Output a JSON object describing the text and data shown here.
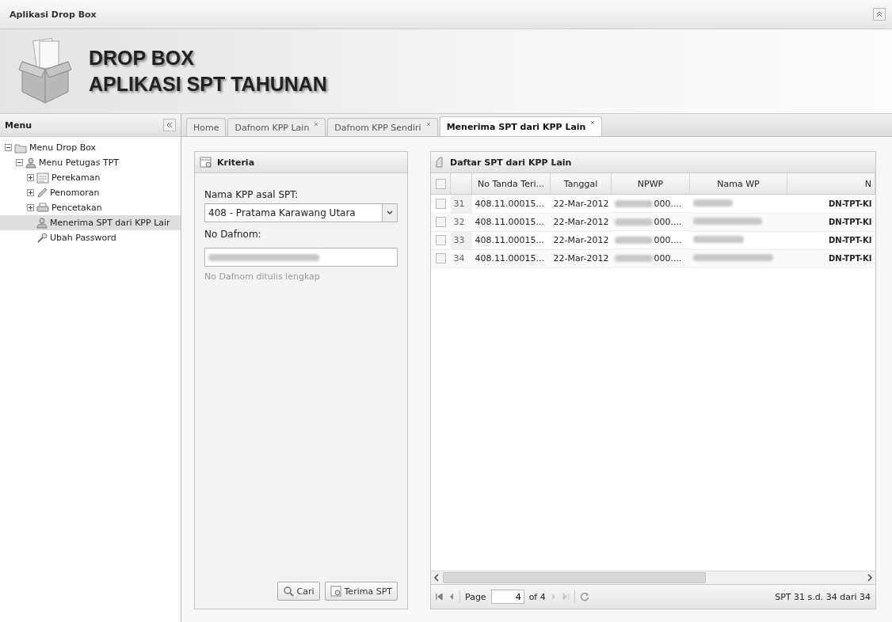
{
  "window": {
    "title": "Aplikasi Drop Box"
  },
  "banner": {
    "line_1": "DROP BOX",
    "line_2": "APLIKASI SPT TAHUNAN"
  },
  "menu": {
    "title": "Menu",
    "items": [
      {
        "label": "Menu Drop Box",
        "kind": "folder",
        "expanded": true,
        "selected": false,
        "children": [
          {
            "label": "Menu Petugas TPT",
            "kind": "user",
            "expanded": true,
            "selected": false,
            "children": [
              {
                "label": "Perekaman",
                "kind": "form",
                "expanded": false,
                "selected": false
              },
              {
                "label": "Penomoran",
                "kind": "pencil",
                "expanded": false,
                "selected": false
              },
              {
                "label": "Pencetakan",
                "kind": "printer",
                "expanded": false,
                "selected": false
              },
              {
                "label": "Menerima SPT dari KPP Lair",
                "kind": "user",
                "selected": true
              },
              {
                "label": "Ubah Password",
                "kind": "key",
                "selected": false
              }
            ]
          }
        ]
      }
    ]
  },
  "tabs": [
    {
      "label": "Home",
      "closable": false,
      "selected": false
    },
    {
      "label": "Dafnom KPP Lain",
      "closable": true,
      "selected": false
    },
    {
      "label": "Dafnom KPP Sendiri",
      "closable": true,
      "selected": false
    },
    {
      "label": "Menerima SPT dari KPP Lain",
      "closable": true,
      "selected": true
    }
  ],
  "criteria": {
    "title": "Kriteria",
    "kpp_label": "Nama KPP asal SPT:",
    "kpp_value": "408 - Pratama Karawang Utara",
    "dafnom_label": "No Dafnom:",
    "dafnom_hint": "No Dafnom ditulis lengkap",
    "buttons": [
      {
        "label": "Cari",
        "kind": "search"
      },
      {
        "label": "Terima SPT",
        "kind": "receive"
      }
    ]
  },
  "grid": {
    "title": "Daftar SPT dari KPP Lain",
    "all_checked": false,
    "columns": [
      "No Tanda Teri...",
      "Tanggal",
      "NPWP",
      "Nama WP",
      "N"
    ],
    "rows": [
      {
        "number": "31",
        "checked": false,
        "no_tanda": "408.11.00015...",
        "tanggal": "22-Mar-2012",
        "npwp": "000....",
        "column_5": "DN-TPT-KI"
      },
      {
        "number": "32",
        "checked": false,
        "no_tanda": "408.11.00015...",
        "tanggal": "22-Mar-2012",
        "npwp": "000....",
        "column_5": "DN-TPT-KI"
      },
      {
        "number": "33",
        "checked": false,
        "no_tanda": "408.11.00015...",
        "tanggal": "22-Mar-2012",
        "npwp": "000....",
        "column_5": "DN-TPT-KI"
      },
      {
        "number": "34",
        "checked": false,
        "no_tanda": "408.11.00015...",
        "tanggal": "22-Mar-2012",
        "npwp": "000....",
        "column_5": "DN-TPT-KI"
      }
    ],
    "pager": {
      "page_label": "Page",
      "page": "4",
      "of": "of 4",
      "summary": "SPT 31 s.d. 34 dari 34"
    }
  }
}
